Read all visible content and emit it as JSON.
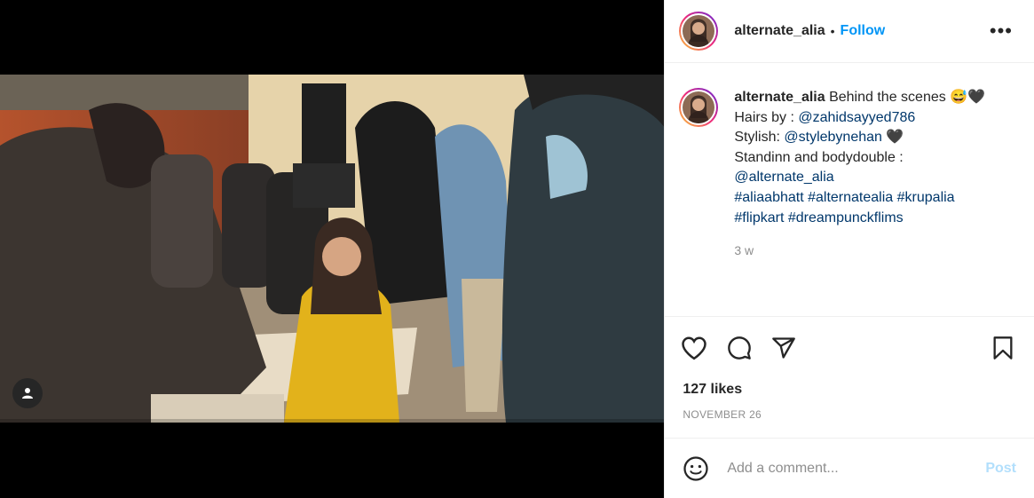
{
  "post": {
    "username": "alternate_alia",
    "follow_label": "Follow",
    "separator": "•",
    "more_label": "•••",
    "caption": {
      "username": "alternate_alia",
      "line1_text": " Behind the scenes ",
      "line1_emoji": "😅🖤",
      "line2_prefix": "Hairs by : ",
      "line2_mention": "@zahidsayyed786",
      "line3_prefix": "Stylish: ",
      "line3_mention": "@stylebynehan",
      "line3_emoji": " 🖤",
      "line4_text": "Standinn and bodydouble :",
      "line5_mention": "@alternate_alia",
      "hashtags_row1": [
        "#aliaabhatt",
        "#alternatealia",
        "#krupalia"
      ],
      "hashtags_row2": [
        "#flipkart",
        "#dreampunckflims"
      ]
    },
    "relative_time": "3 w",
    "likes": "127 likes",
    "date": "NOVEMBER 26",
    "comment_placeholder": "Add a comment...",
    "post_label": "Post"
  },
  "icons": {
    "like": "heart-icon",
    "comment": "comment-icon",
    "share": "paper-plane-icon",
    "save": "bookmark-icon",
    "emoji": "smiley-icon",
    "user_tag": "user-icon"
  }
}
